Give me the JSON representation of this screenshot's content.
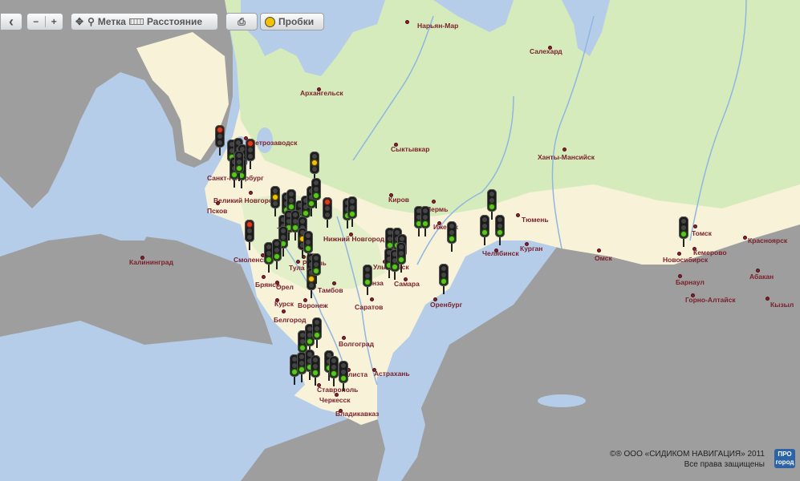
{
  "toolbar": {
    "back_label": "‹",
    "zoom_out_label": "−",
    "zoom_in_label": "+",
    "marker_label": "Метка",
    "distance_label": "Расстояние",
    "traffic_label": "Пробки"
  },
  "colors": {
    "land": "#f7f2d8",
    "forest": "#d6ebbb",
    "water": "#b5cde8",
    "outside": "#9e9e9e",
    "river": "#8fb6e2",
    "city_label": "#7a1f2b"
  },
  "cities": [
    {
      "name": "Нарьян-Мар"
    },
    {
      "name": "Салехард"
    },
    {
      "name": "Архангельск"
    },
    {
      "name": "Петрозаводск"
    },
    {
      "name": "Сыктывкар"
    },
    {
      "name": "Ханты-Мансийск"
    },
    {
      "name": "Санкт-Петербург"
    },
    {
      "name": "Великий Новгород"
    },
    {
      "name": "Псков"
    },
    {
      "name": "Киров"
    },
    {
      "name": "Пермь"
    },
    {
      "name": "Тюмень"
    },
    {
      "name": "Томск"
    },
    {
      "name": "Красноярск"
    },
    {
      "name": "Калининград"
    },
    {
      "name": "Смоленск"
    },
    {
      "name": "Нижний Новгород"
    },
    {
      "name": "Ижевск"
    },
    {
      "name": "Челябинск"
    },
    {
      "name": "Курган"
    },
    {
      "name": "Омск"
    },
    {
      "name": "Новосибирск"
    },
    {
      "name": "Кемерово"
    },
    {
      "name": "Брянск"
    },
    {
      "name": "Тула"
    },
    {
      "name": "Ульяновск"
    },
    {
      "name": "Абакан"
    },
    {
      "name": "Барнаул"
    },
    {
      "name": "Орел"
    },
    {
      "name": "Пенза"
    },
    {
      "name": "Самара"
    },
    {
      "name": "Тамбов"
    },
    {
      "name": "Курск"
    },
    {
      "name": "Воронеж"
    },
    {
      "name": "Саратов"
    },
    {
      "name": "Оренбург"
    },
    {
      "name": "Горно-Алтайск"
    },
    {
      "name": "Кызыл"
    },
    {
      "name": "Белгород"
    },
    {
      "name": "Волгоград"
    },
    {
      "name": "Элиста"
    },
    {
      "name": "Астрахань"
    },
    {
      "name": "Ставрополь"
    },
    {
      "name": "Черкесск"
    },
    {
      "name": "Владикавказ"
    },
    {
      "name": "Тверь"
    },
    {
      "name": "Рязань"
    }
  ],
  "traffic_lights": [
    "red",
    "green",
    "green",
    "green",
    "yellow",
    "red",
    "green",
    "green",
    "green",
    "yellow",
    "green",
    "green",
    "green",
    "green",
    "green",
    "red",
    "green",
    "green",
    "green",
    "green",
    "green",
    "red",
    "green",
    "green",
    "green",
    "green",
    "green",
    "green",
    "green",
    "green",
    "green",
    "green",
    "green",
    "green",
    "green",
    "green",
    "green",
    "green",
    "green",
    "green",
    "yellow",
    "green",
    "green",
    "yellow",
    "green",
    "green",
    "green",
    "green",
    "green",
    "green",
    "green",
    "green",
    "green",
    "green",
    "green",
    "green",
    "green"
  ],
  "copyright": {
    "line1": "©® ООО «СИДИКОМ НАВИГАЦИЯ» 2011",
    "line2": "Все права защищены",
    "logo": "ПРО город"
  }
}
